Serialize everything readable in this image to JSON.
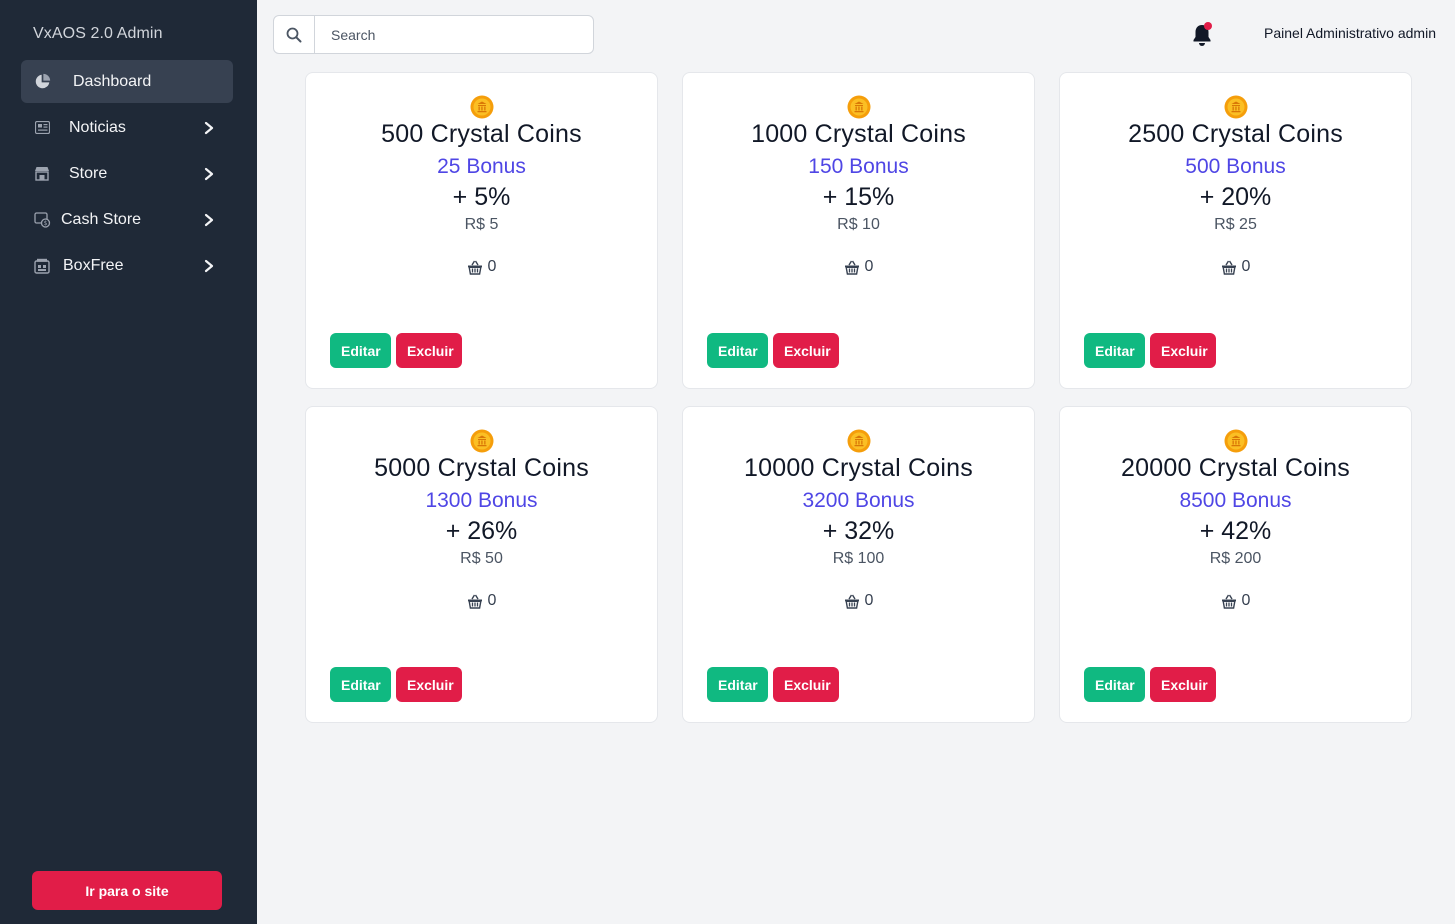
{
  "app": {
    "title": "VxAOS 2.0 Admin"
  },
  "sidebar": {
    "items": [
      {
        "label": "Dashboard",
        "icon": "pie-chart-icon",
        "active": true,
        "chevron": false
      },
      {
        "label": "Noticias",
        "icon": "newspaper-icon",
        "active": false,
        "chevron": true
      },
      {
        "label": "Store",
        "icon": "store-icon",
        "active": false,
        "chevron": true
      },
      {
        "label": "Cash Store",
        "icon": "cash-icon",
        "active": false,
        "chevron": true
      },
      {
        "label": "BoxFree",
        "icon": "box-icon",
        "active": false,
        "chevron": true
      }
    ],
    "site_button": "Ir para o site"
  },
  "header": {
    "search_placeholder": "Search",
    "user_label": "Painel Administrativo admin"
  },
  "cards": [
    {
      "title": "500 Crystal Coins",
      "bonus": "25 Bonus",
      "percent": "+ 5%",
      "price": "R$ 5",
      "sales": "0",
      "edit_label": "Editar",
      "delete_label": "Excluir"
    },
    {
      "title": "1000 Crystal Coins",
      "bonus": "150 Bonus",
      "percent": "+ 15%",
      "price": "R$ 10",
      "sales": "0",
      "edit_label": "Editar",
      "delete_label": "Excluir"
    },
    {
      "title": "2500 Crystal Coins",
      "bonus": "500 Bonus",
      "percent": "+ 20%",
      "price": "R$ 25",
      "sales": "0",
      "edit_label": "Editar",
      "delete_label": "Excluir"
    },
    {
      "title": "5000 Crystal Coins",
      "bonus": "1300 Bonus",
      "percent": "+ 26%",
      "price": "R$ 50",
      "sales": "0",
      "edit_label": "Editar",
      "delete_label": "Excluir"
    },
    {
      "title": "10000 Crystal Coins",
      "bonus": "3200 Bonus",
      "percent": "+ 32%",
      "price": "R$ 100",
      "sales": "0",
      "edit_label": "Editar",
      "delete_label": "Excluir"
    },
    {
      "title": "20000 Crystal Coins",
      "bonus": "8500 Bonus",
      "percent": "+ 42%",
      "price": "R$ 200",
      "sales": "0",
      "edit_label": "Editar",
      "delete_label": "Excluir"
    }
  ],
  "colors": {
    "sidebar_bg": "#1f2937",
    "active_item_bg": "#374151",
    "bonus": "#4f46e5",
    "edit": "#10b981",
    "delete": "#e11d48",
    "coin": "#f59e0b"
  }
}
